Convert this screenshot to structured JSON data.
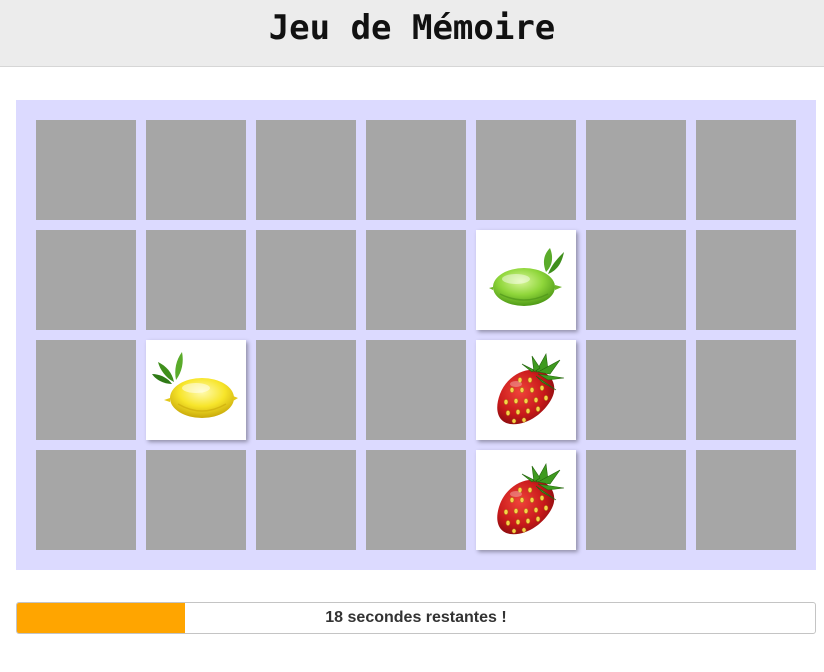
{
  "header": {
    "title": "Jeu de Mémoire"
  },
  "board": {
    "rows": 4,
    "columns": 7,
    "colors": {
      "background": "#dcdaff",
      "card_back": "#a6a6a6",
      "card_face": "#ffffff"
    },
    "revealed_cards": [
      {
        "row": 2,
        "column": 5,
        "fruit": "lime-icon"
      },
      {
        "row": 3,
        "column": 2,
        "fruit": "lemon-icon"
      },
      {
        "row": 3,
        "column": 5,
        "fruit": "strawberry-icon"
      },
      {
        "row": 4,
        "column": 5,
        "fruit": "strawberry-icon"
      }
    ]
  },
  "timer": {
    "label": "18 secondes restantes !",
    "progress_fraction": 0.21,
    "fill_color": "#ffa500"
  }
}
